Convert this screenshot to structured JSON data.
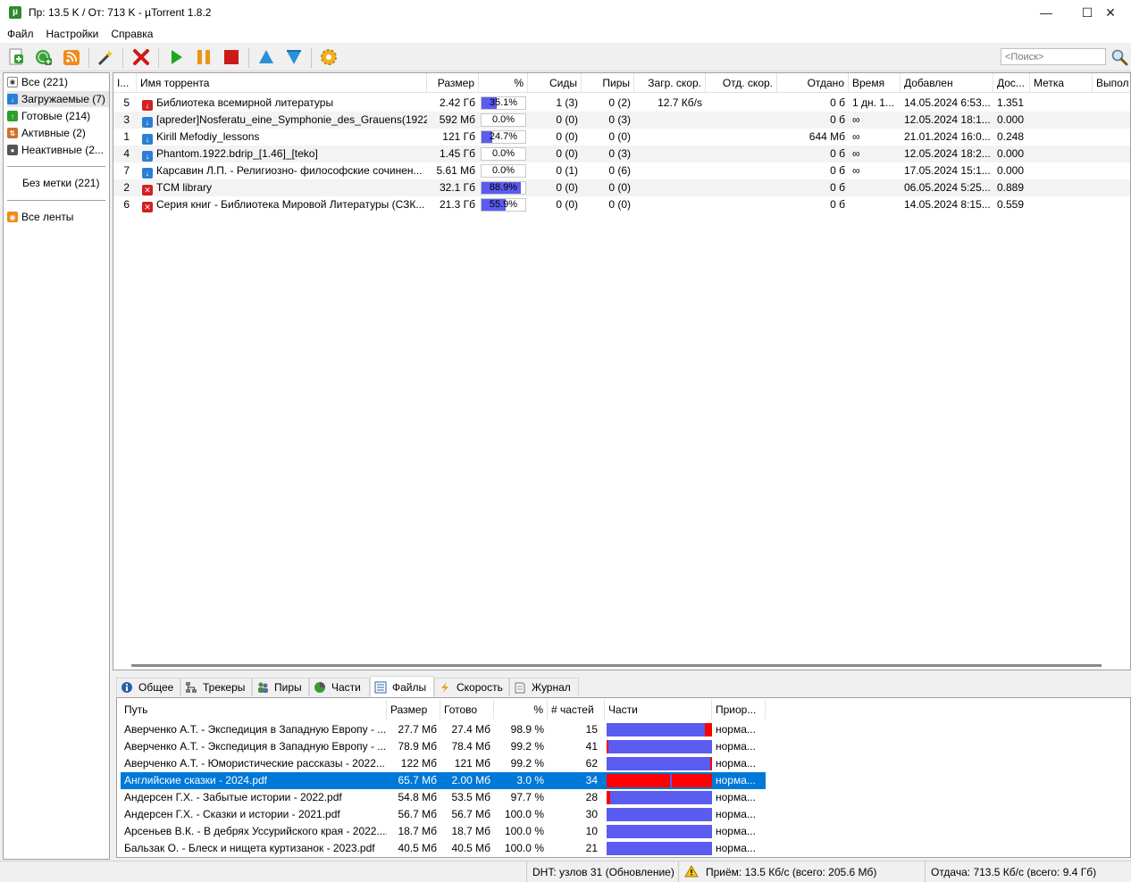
{
  "window": {
    "title": "Пр: 13.5 K / От: 713 K  -  µTorrent 1.8.2",
    "app_icon": "µ"
  },
  "menu": [
    "Файл",
    "Настройки",
    "Справка"
  ],
  "search": {
    "placeholder": "<Поиск>"
  },
  "toolbar_icons": [
    "add-torrent-icon",
    "add-url-icon",
    "rss-icon",
    "create-torrent-icon",
    "remove-icon",
    "start-icon",
    "pause-icon",
    "stop-icon",
    "move-up-icon",
    "move-down-icon",
    "settings-icon"
  ],
  "sidebar": {
    "items": [
      {
        "label": "Все (221)",
        "icon": "all-icon",
        "color": "#555555"
      },
      {
        "label": "Загружаемые (7)",
        "icon": "download-icon",
        "color": "#2a7fd4"
      },
      {
        "label": "Готовые (214)",
        "icon": "completed-icon",
        "color": "#2e9e2e"
      },
      {
        "label": "Активные (2)",
        "icon": "active-icon",
        "color": "#d0702a"
      },
      {
        "label": "Неактивные (2...",
        "icon": "inactive-icon",
        "color": "#555555"
      }
    ],
    "no_label": "Без метки (221)",
    "feeds": "Все ленты"
  },
  "torrent_columns": [
    "I...",
    "Имя торрента",
    "Размер",
    "%",
    "Сиды",
    "Пиры",
    "Загр. скор.",
    "Отд. скор.",
    "Отдано",
    "Время",
    "Добавлен",
    "Дос...",
    "Метка",
    "Выпол"
  ],
  "torrents": [
    {
      "num": "5",
      "status": "error",
      "name": "Библиотека всемирной литературы",
      "size": "2.42 Гб",
      "percent_text": "35.1%",
      "percent": 35.1,
      "seeds": "1 (3)",
      "peers": "0 (2)",
      "down": "12.7 Кб/s",
      "up": "",
      "uploaded": "0 б",
      "time": "1 дн. 1...",
      "added": "14.05.2024 6:53...",
      "ratio": "1.351"
    },
    {
      "num": "3",
      "status": "downloading",
      "name": "[apreder]Nosferatu_eine_Symphonie_des_Grauens(1922...",
      "size": "592 Мб",
      "percent_text": "0.0%",
      "percent": 0,
      "seeds": "0 (0)",
      "peers": "0 (3)",
      "down": "",
      "up": "",
      "uploaded": "0 б",
      "time": "∞",
      "added": "12.05.2024 18:1...",
      "ratio": "0.000"
    },
    {
      "num": "1",
      "status": "downloading",
      "name": "Kirill Mefodiy_lessons",
      "size": "121 Гб",
      "percent_text": "24.7%",
      "percent": 24.7,
      "seeds": "0 (0)",
      "peers": "0 (0)",
      "down": "",
      "up": "",
      "uploaded": "644 Мб",
      "time": "∞",
      "added": "21.01.2024 16:0...",
      "ratio": "0.248"
    },
    {
      "num": "4",
      "status": "downloading",
      "name": "Phantom.1922.bdrip_[1.46]_[teko]",
      "size": "1.45 Гб",
      "percent_text": "0.0%",
      "percent": 0,
      "seeds": "0 (0)",
      "peers": "0 (3)",
      "down": "",
      "up": "",
      "uploaded": "0 б",
      "time": "∞",
      "added": "12.05.2024 18:2...",
      "ratio": "0.000"
    },
    {
      "num": "7",
      "status": "downloading",
      "name": "Карсавин Л.П. - Религиозно- философские сочинен...",
      "size": "5.61 Мб",
      "percent_text": "0.0%",
      "percent": 0,
      "seeds": "0 (1)",
      "peers": "0 (6)",
      "down": "",
      "up": "",
      "uploaded": "0 б",
      "time": "∞",
      "added": "17.05.2024 15:1...",
      "ratio": "0.000"
    },
    {
      "num": "2",
      "status": "stopped-error",
      "name": "TCM library",
      "size": "32.1 Гб",
      "percent_text": "88.9%",
      "percent": 88.9,
      "seeds": "0 (0)",
      "peers": "0 (0)",
      "down": "",
      "up": "",
      "uploaded": "0 б",
      "time": "",
      "added": "06.05.2024 5:25...",
      "ratio": "0.889"
    },
    {
      "num": "6",
      "status": "stopped-error",
      "name": "Серия книг - Библиотека Мировой Литературы (СЗК...",
      "size": "21.3 Гб",
      "percent_text": "55.9%",
      "percent": 55.9,
      "seeds": "0 (0)",
      "peers": "0 (0)",
      "down": "",
      "up": "",
      "uploaded": "0 б",
      "time": "",
      "added": "14.05.2024 8:15...",
      "ratio": "0.559"
    }
  ],
  "tabs": [
    {
      "label": "Общее",
      "icon": "info-icon"
    },
    {
      "label": "Трекеры",
      "icon": "trackers-icon"
    },
    {
      "label": "Пиры",
      "icon": "peers-icon"
    },
    {
      "label": "Части",
      "icon": "pieces-icon"
    },
    {
      "label": "Файлы",
      "icon": "files-icon",
      "active": true
    },
    {
      "label": "Скорость",
      "icon": "speed-icon"
    },
    {
      "label": "Журнал",
      "icon": "log-icon"
    }
  ],
  "file_columns": [
    "Путь",
    "Размер",
    "Готово",
    "%",
    "# частей",
    "Части",
    "Приор..."
  ],
  "files": [
    {
      "path": "Аверченко А.Т. - Экспедиция в Западную Европу - ...",
      "size": "27.7 Мб",
      "done": "27.4 Мб",
      "percent": "98.9 %",
      "pieces": "15",
      "priority": "норма...",
      "missing": [
        [
          0.93,
          1.0
        ]
      ]
    },
    {
      "path": "Аверченко А.Т. - Экспедиция в Западную Европу - ...",
      "size": "78.9 Мб",
      "done": "78.4 Мб",
      "percent": "99.2 %",
      "pieces": "41",
      "priority": "норма...",
      "missing": [
        [
          0.0,
          0.02
        ]
      ]
    },
    {
      "path": "Аверченко А.Т. - Юмористические рассказы - 2022...",
      "size": "122 Мб",
      "done": "121 Мб",
      "percent": "99.2 %",
      "pieces": "62",
      "priority": "норма...",
      "missing": [
        [
          0.98,
          1.0
        ]
      ]
    },
    {
      "path": "Английские сказки - 2024.pdf",
      "size": "65.7 Мб",
      "done": "2.00 Мб",
      "percent": "3.0 %",
      "pieces": "34",
      "priority": "норма...",
      "selected": true,
      "missing": [
        [
          0.0,
          0.6
        ],
        [
          0.62,
          1.0
        ]
      ]
    },
    {
      "path": "Андерсен Г.Х. - Забытые истории - 2022.pdf",
      "size": "54.8 Мб",
      "done": "53.5 Мб",
      "percent": "97.7 %",
      "pieces": "28",
      "priority": "норма...",
      "missing": [
        [
          0.0,
          0.03
        ]
      ]
    },
    {
      "path": "Андерсен Г.Х. - Сказки и истории - 2021.pdf",
      "size": "56.7 Мб",
      "done": "56.7 Мб",
      "percent": "100.0 %",
      "pieces": "30",
      "priority": "норма...",
      "missing": []
    },
    {
      "path": "Арсеньев В.К. - В дебрях Уссурийского края - 2022....",
      "size": "18.7 Мб",
      "done": "18.7 Мб",
      "percent": "100.0 %",
      "pieces": "10",
      "priority": "норма...",
      "missing": []
    },
    {
      "path": "Бальзак О. - Блеск и нищета куртизанок - 2023.pdf",
      "size": "40.5 Мб",
      "done": "40.5 Мб",
      "percent": "100.0 %",
      "pieces": "21",
      "priority": "норма...",
      "missing": []
    }
  ],
  "status": {
    "dht": "DHT: узлов 31  (Обновление)",
    "download": "Приём: 13.5 Кб/с (всего: 205.6 Мб)",
    "upload": "Отдача: 713.5 Кб/с (всего: 9.4 Гб)"
  },
  "colors": {
    "progress": "#5a5cf0",
    "missing": "#ff0000",
    "selection": "#0078d7"
  }
}
